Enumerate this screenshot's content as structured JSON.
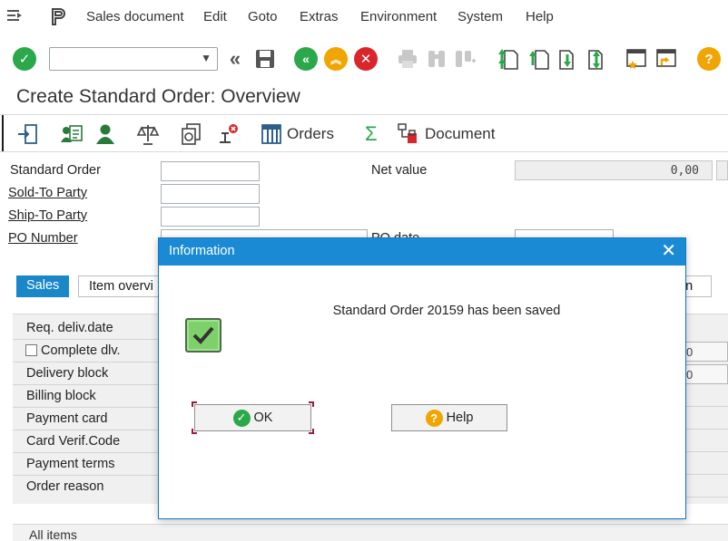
{
  "menu": {
    "items": [
      {
        "label": "Sales document"
      },
      {
        "label": "Edit"
      },
      {
        "label": "Goto"
      },
      {
        "label": "Extras"
      },
      {
        "label": "Environment"
      },
      {
        "label": "System"
      },
      {
        "label": "Help"
      }
    ]
  },
  "command_field": {
    "value": ""
  },
  "page": {
    "title": "Create Standard Order: Overview"
  },
  "app_toolbar": {
    "orders_label": "Orders",
    "document_label": "Document"
  },
  "header": {
    "standard_order_label": "Standard Order",
    "sold_to_label": "Sold-To Party",
    "ship_to_label": "Ship-To Party",
    "po_number_label": "PO Number",
    "net_value_label": "Net value",
    "net_value": "0,00",
    "po_date_label": "PO date"
  },
  "tabs": {
    "sales": "Sales",
    "item_overview": "Item overvi",
    "right_partial": "on"
  },
  "sales_fields": {
    "req_deliv_date": "Req. deliv.date",
    "complete_dlv": "Complete dlv.",
    "delivery_block": "Delivery block",
    "billing_block": "Billing block",
    "payment_card": "Payment card",
    "card_verif_code": "Card Verif.Code",
    "payment_terms": "Payment terms",
    "order_reason": "Order reason",
    "right_val_1": "0",
    "right_val_2": "0"
  },
  "bottom": {
    "all_items": "All items"
  },
  "dialog": {
    "title": "Information",
    "message": "Standard Order 20159 has been saved",
    "ok_label": "OK",
    "help_label": "Help"
  },
  "colors": {
    "accent_blue": "#1a8ad4",
    "green_ok": "#2aa84a",
    "orange_help": "#f0a500",
    "red_cancel": "#d9262c"
  }
}
